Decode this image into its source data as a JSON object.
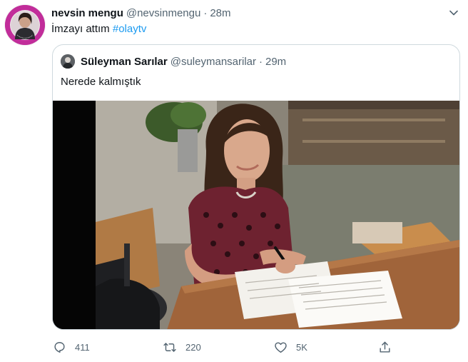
{
  "tweet": {
    "author": {
      "name": "nevsin mengu",
      "handle": "@nevsinmengu",
      "avatar_icon": "profile-photo-avatar"
    },
    "separator": "·",
    "time": "28m",
    "text": "İmzayı attım",
    "hashtag": "#olaytv",
    "more_icon": "chevron-down-icon"
  },
  "quoted_tweet": {
    "author": {
      "name": "Süleyman Sarılar",
      "handle": "@suleymansarilar",
      "avatar_icon": "profile-photo-avatar"
    },
    "separator": "·",
    "time": "29m",
    "text": "Nerede kalmıştık",
    "media_icon": "photo-woman-signing-document"
  },
  "actions": {
    "reply": {
      "icon": "reply-icon",
      "count": "411"
    },
    "retweet": {
      "icon": "retweet-icon",
      "count": "220"
    },
    "like": {
      "icon": "heart-icon",
      "count": "5K"
    },
    "share": {
      "icon": "share-icon"
    }
  },
  "colors": {
    "text": "#0f1419",
    "secondary": "#536471",
    "link": "#1d9bf0",
    "border": "#cfd9de",
    "avatar_ring": "#c12d9a"
  }
}
